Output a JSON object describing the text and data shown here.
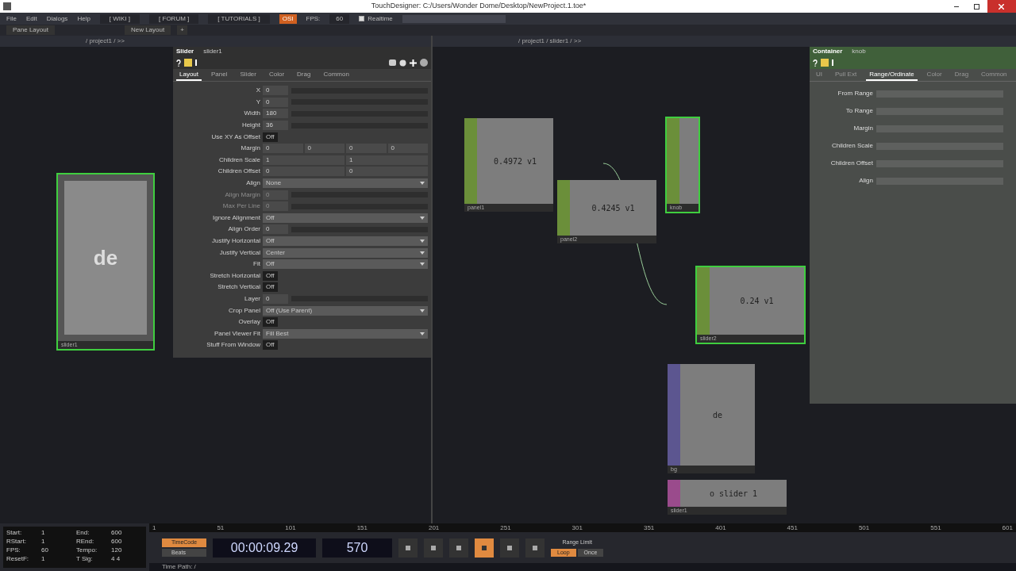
{
  "window": {
    "title": "TouchDesigner: C:/Users/Wonder Dome/Desktop/NewProject.1.toe*"
  },
  "menu": [
    "File",
    "Edit",
    "Dialogs",
    "Help"
  ],
  "toolbar": {
    "links": [
      "[ WIKI ]",
      "[ FORUM ]",
      "[ TUTORIALS ]"
    ],
    "badge": "OSI",
    "fps_label": "FPS:",
    "fps": "60",
    "realtime": {
      "label": "Realtime",
      "checked": true
    }
  },
  "layout_bar": {
    "pane_layout": "Pane Layout",
    "new_layout": "New Layout",
    "add": "+"
  },
  "left_pane": {
    "path": "/ project1 / >>",
    "node": {
      "name": "slider1",
      "display": "de",
      "selected": true
    }
  },
  "params": {
    "type": "Slider",
    "name": "slider1",
    "tabs": [
      {
        "label": "Layout",
        "selected": true
      },
      {
        "label": "Panel",
        "selected": false
      },
      {
        "label": "Slider",
        "selected": false
      },
      {
        "label": "Color",
        "selected": false
      },
      {
        "label": "Drag",
        "selected": false
      },
      {
        "label": "Common",
        "selected": false
      }
    ],
    "rows": [
      {
        "label": "X",
        "kind": "number",
        "value": "0",
        "disabled": false
      },
      {
        "label": "Y",
        "kind": "number",
        "value": "0",
        "disabled": false
      },
      {
        "label": "Width",
        "kind": "number",
        "value": "180",
        "disabled": false
      },
      {
        "label": "Height",
        "kind": "number",
        "value": "36",
        "disabled": false
      },
      {
        "label": "Use XY As Offset",
        "kind": "toggle",
        "value": "Off",
        "disabled": false
      },
      {
        "label": "Margin",
        "kind": "multi",
        "values": [
          "0",
          "0",
          "0",
          "0"
        ],
        "disabled": false
      },
      {
        "label": "Children Scale",
        "kind": "multi",
        "values": [
          "1",
          "1"
        ],
        "disabled": false
      },
      {
        "label": "Children Offset",
        "kind": "multi",
        "values": [
          "0",
          "0"
        ],
        "disabled": false
      },
      {
        "label": "Align",
        "kind": "menu",
        "value": "None",
        "disabled": false
      },
      {
        "label": "Align Margin",
        "kind": "number",
        "value": "0",
        "disabled": true
      },
      {
        "label": "Max Per Line",
        "kind": "number",
        "value": "0",
        "disabled": true
      },
      {
        "label": "Ignore Alignment",
        "kind": "menu",
        "value": "Off",
        "disabled": false
      },
      {
        "label": "Align Order",
        "kind": "number",
        "value": "0",
        "disabled": false
      },
      {
        "label": "Justify Horizontal",
        "kind": "menu",
        "value": "Off",
        "disabled": false
      },
      {
        "label": "Justify Vertical",
        "kind": "menu",
        "value": "Center",
        "disabled": false
      },
      {
        "label": "Fit",
        "kind": "menu",
        "value": "Off",
        "disabled": false
      },
      {
        "label": "Stretch Horizontal",
        "kind": "toggle",
        "value": "Off",
        "disabled": false
      },
      {
        "label": "Stretch Vertical",
        "kind": "toggle",
        "value": "Off",
        "disabled": false
      },
      {
        "label": "Layer",
        "kind": "number",
        "value": "0",
        "disabled": false
      },
      {
        "label": "Crop Panel",
        "kind": "menu",
        "value": "Off (Use Parent)",
        "disabled": false
      },
      {
        "label": "Overlay",
        "kind": "toggle",
        "value": "Off",
        "disabled": false
      },
      {
        "label": "Panel Viewer Fit",
        "kind": "menu",
        "value": "Fill Best",
        "disabled": false
      },
      {
        "label": "Stuff From Window",
        "kind": "toggle",
        "value": "Off",
        "disabled": false
      }
    ]
  },
  "right_pane": {
    "path": "/ project1 / slider1 / >>",
    "nodes": [
      {
        "name": "panel1",
        "value": "0.4972 v1",
        "color": "#6b8f3a",
        "selected": false
      },
      {
        "name": "panel2",
        "value": "0.4245 v1",
        "color": "#6b8f3a",
        "selected": false
      },
      {
        "name": "knob",
        "color": "#6b8f3a",
        "selected": true
      },
      {
        "name": "slider2",
        "value": "0.24 v1",
        "color": "#6b8f3a",
        "selected": true
      },
      {
        "name": "bg",
        "value": "de",
        "color": "#5c5690",
        "selected": false
      },
      {
        "name": "slider1",
        "value": "o slider 1",
        "color": "#9a4b8c",
        "selected": false
      }
    ],
    "panel": {
      "type": "Container",
      "name": "knob",
      "tabs": [
        {
          "label": "UI",
          "selected": false
        },
        {
          "label": "Pull Ext",
          "selected": false
        },
        {
          "label": "Range/Ordinate",
          "selected": true
        },
        {
          "label": "Color",
          "selected": false
        },
        {
          "label": "Drag",
          "selected": false
        },
        {
          "label": "Common",
          "selected": false
        }
      ],
      "rows": [
        "From Range",
        "To Range",
        "Margin",
        "Children Scale",
        "Children Offset",
        "Align"
      ]
    }
  },
  "timeline": {
    "stats": [
      [
        "Start:",
        "1"
      ],
      [
        "End:",
        "600"
      ],
      [
        "RStart:",
        "1"
      ],
      [
        "REnd:",
        "600"
      ],
      [
        "FPS:",
        "60"
      ],
      [
        "Tempo:",
        "120"
      ],
      [
        "ResetF:",
        "1"
      ],
      [
        "T Sig:",
        "4  4"
      ]
    ],
    "ticks": [
      "1",
      "51",
      "101",
      "151",
      "201",
      "251",
      "301",
      "351",
      "401",
      "451",
      "501",
      "551",
      "601"
    ],
    "modes": [
      {
        "label": "TimeCode",
        "selected": true
      },
      {
        "label": "Beats",
        "selected": false
      }
    ],
    "time": "00:00:09.29",
    "frame": "570",
    "range_limit": "Range Limit",
    "range_modes": [
      {
        "label": "Loop",
        "selected": true
      },
      {
        "label": "Once",
        "selected": false
      }
    ],
    "time_path": "Time Path: /"
  }
}
